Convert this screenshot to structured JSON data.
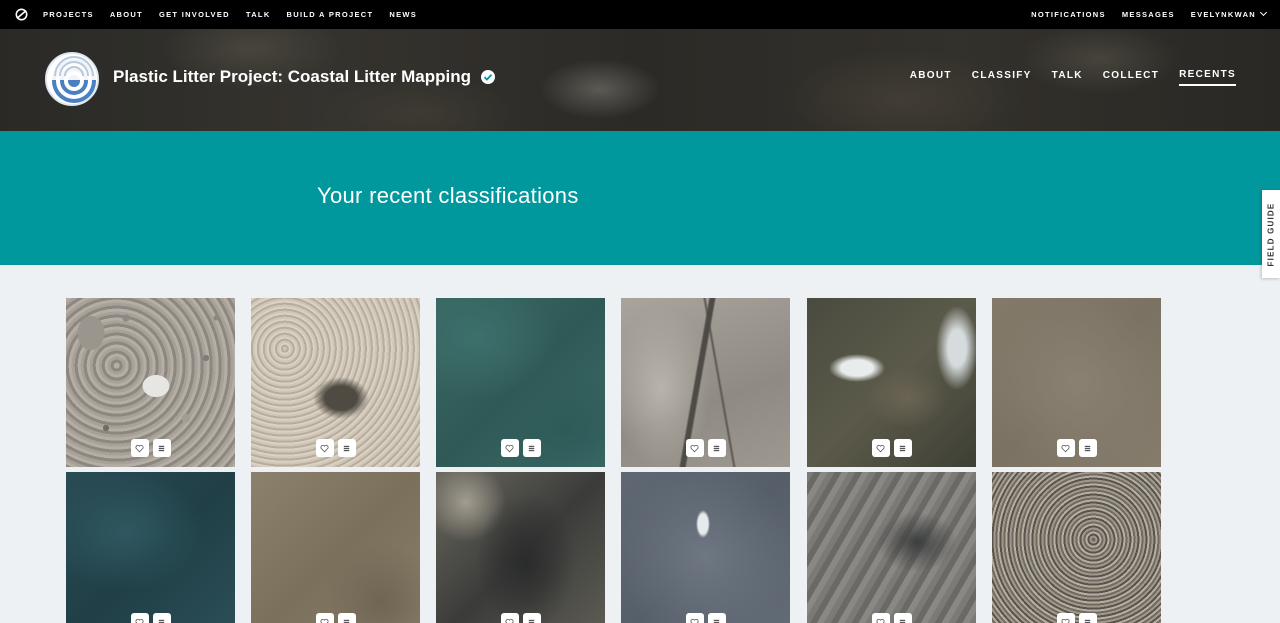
{
  "topnav": {
    "left": [
      "Projects",
      "About",
      "Get Involved",
      "Talk",
      "Build a Project",
      "News"
    ],
    "right": [
      "Notifications",
      "Messages"
    ],
    "user": "EVELYNKWAN"
  },
  "project": {
    "title": "Plastic Litter Project: Coastal Litter Mapping",
    "nav": [
      "ABOUT",
      "CLASSIFY",
      "TALK",
      "COLLECT",
      "RECENTS"
    ],
    "active_nav": "RECENTS"
  },
  "banner": {
    "heading": "Your recent classifications"
  },
  "field_guide": "FIELD GUIDE",
  "thumbnails": [
    {
      "icon_fav": "heart-icon",
      "icon_collect": "list-icon"
    },
    {
      "icon_fav": "heart-icon",
      "icon_collect": "list-icon"
    },
    {
      "icon_fav": "heart-icon",
      "icon_collect": "list-icon"
    },
    {
      "icon_fav": "heart-icon",
      "icon_collect": "list-icon"
    },
    {
      "icon_fav": "heart-icon",
      "icon_collect": "list-icon"
    },
    {
      "icon_fav": "heart-icon",
      "icon_collect": "list-icon"
    },
    {
      "icon_fav": "heart-icon",
      "icon_collect": "list-icon"
    },
    {
      "icon_fav": "heart-icon",
      "icon_collect": "list-icon"
    },
    {
      "icon_fav": "heart-icon",
      "icon_collect": "list-icon"
    },
    {
      "icon_fav": "heart-icon",
      "icon_collect": "list-icon"
    },
    {
      "icon_fav": "heart-icon",
      "icon_collect": "list-icon"
    },
    {
      "icon_fav": "heart-icon",
      "icon_collect": "list-icon"
    }
  ],
  "colors": {
    "banner": "#00979d",
    "topbar": "#000000",
    "page_bg": "#eef1f4"
  }
}
